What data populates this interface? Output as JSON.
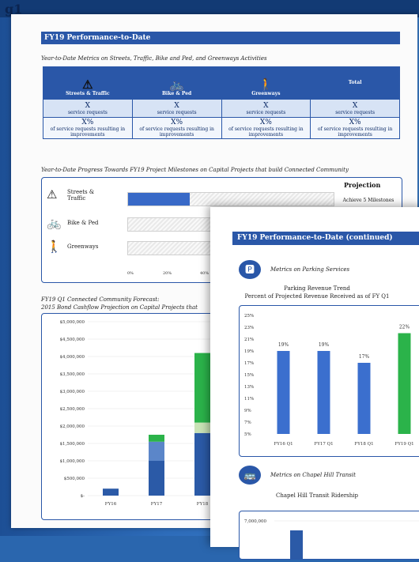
{
  "background_label": "g1",
  "page1": {
    "title": "FY19 Performance-to-Date",
    "metrics_subtitle": "Year-to-Date Metrics on Streets, Traffic, Bike and Ped, and Greenways Activities",
    "metrics_columns": [
      {
        "label": "Streets & Traffic",
        "icon": "traffic-cone-icon",
        "glyph": "⚠"
      },
      {
        "label": "Bike & Ped",
        "icon": "bicycle-icon",
        "glyph": "🚲"
      },
      {
        "label": "Greenways",
        "icon": "hikers-icon",
        "glyph": "🚶"
      },
      {
        "label": "Total",
        "icon": "",
        "glyph": ""
      }
    ],
    "metric_value_x": "X",
    "metric_label_requests": "service requests",
    "metric_value_pct": "X%",
    "metric_label_improve": "of service requests resulting in improvements",
    "progress_subtitle": "Year-to-Date Progress Towards FY19 Project Milestones on Capital Projects that build Connected Community",
    "progress_rows": [
      {
        "label": "Streets & Traffic",
        "icon": "traffic-cone-icon",
        "glyph": "⚠",
        "progress": 0.3
      },
      {
        "label": "Bike & Ped",
        "icon": "bicycle-icon",
        "glyph": "🚲",
        "progress": 0
      },
      {
        "label": "Greenways",
        "icon": "hikers-icon",
        "glyph": "🚶",
        "progress": 0
      }
    ],
    "progress_axis": [
      "0%",
      "20%",
      "40%"
    ],
    "projection_header": "Projection",
    "projection_value": "Achieve 5 Milestones",
    "cashflow_subtitle_1": "FY19 Q1 Connected Community Forecast:",
    "cashflow_subtitle_2": "2015 Bond Cashflow Projection on Capital Projects that"
  },
  "chart_data": [
    {
      "type": "bar",
      "stacked": true,
      "title": "",
      "categories": [
        "FY16",
        "FY17",
        "FY18"
      ],
      "yticks": [
        "$5,000,000",
        "$4,500,000",
        "$4,000,000",
        "$3,500,000",
        "$3,000,000",
        "$2,500,000",
        "$2,000,000",
        "$1,500,000",
        "$1,000,000",
        "$500,000",
        "$-"
      ],
      "ylim": [
        0,
        5000000
      ],
      "series": [
        {
          "name": "",
          "color": "#2b5aa7",
          "values": [
            200000,
            1000000,
            1800000
          ]
        },
        {
          "name": "",
          "color": "#5b86c9",
          "values": [
            0,
            550000,
            0
          ]
        },
        {
          "name": "",
          "color": "#c9e3b6",
          "values": [
            0,
            0,
            300000
          ]
        },
        {
          "name": "",
          "color": "#2bb34a",
          "values": [
            0,
            200000,
            2000000
          ]
        }
      ]
    },
    {
      "type": "bar",
      "title": "Parking Revenue Trend",
      "subtitle": "Percent of Projected Revenue Received as of FY Q1",
      "categories": [
        "FY16 Q1",
        "FY17 Q1",
        "FY18 Q1",
        "FY19 Q1"
      ],
      "values": [
        19,
        19,
        17,
        22
      ],
      "labels": [
        "19%",
        "19%",
        "17%",
        "22%"
      ],
      "colors": [
        "#3b6fce",
        "#3b6fce",
        "#3b6fce",
        "#2bb34a"
      ],
      "yticks": [
        "25%",
        "23%",
        "21%",
        "19%",
        "17%",
        "15%",
        "13%",
        "11%",
        "9%",
        "7%",
        "5%"
      ],
      "ylim": [
        5,
        25
      ]
    }
  ],
  "page2": {
    "title": "FY19 Performance-to-Date (continued)",
    "parking_section": "Metrics on Parking Services",
    "parking_icon": "parking-meter-icon",
    "parking_glyph": "🅿",
    "parking_chart_title": "Parking Revenue Trend",
    "parking_chart_subtitle": "Percent of Projected Revenue Received as of FY Q1",
    "transit_section": "Metrics on Chapel Hill Transit",
    "transit_icon": "bus-icon",
    "transit_glyph": "🚌",
    "transit_chart_title": "Chapel Hill Transit Ridership",
    "transit_ytick": "7,000,000"
  }
}
